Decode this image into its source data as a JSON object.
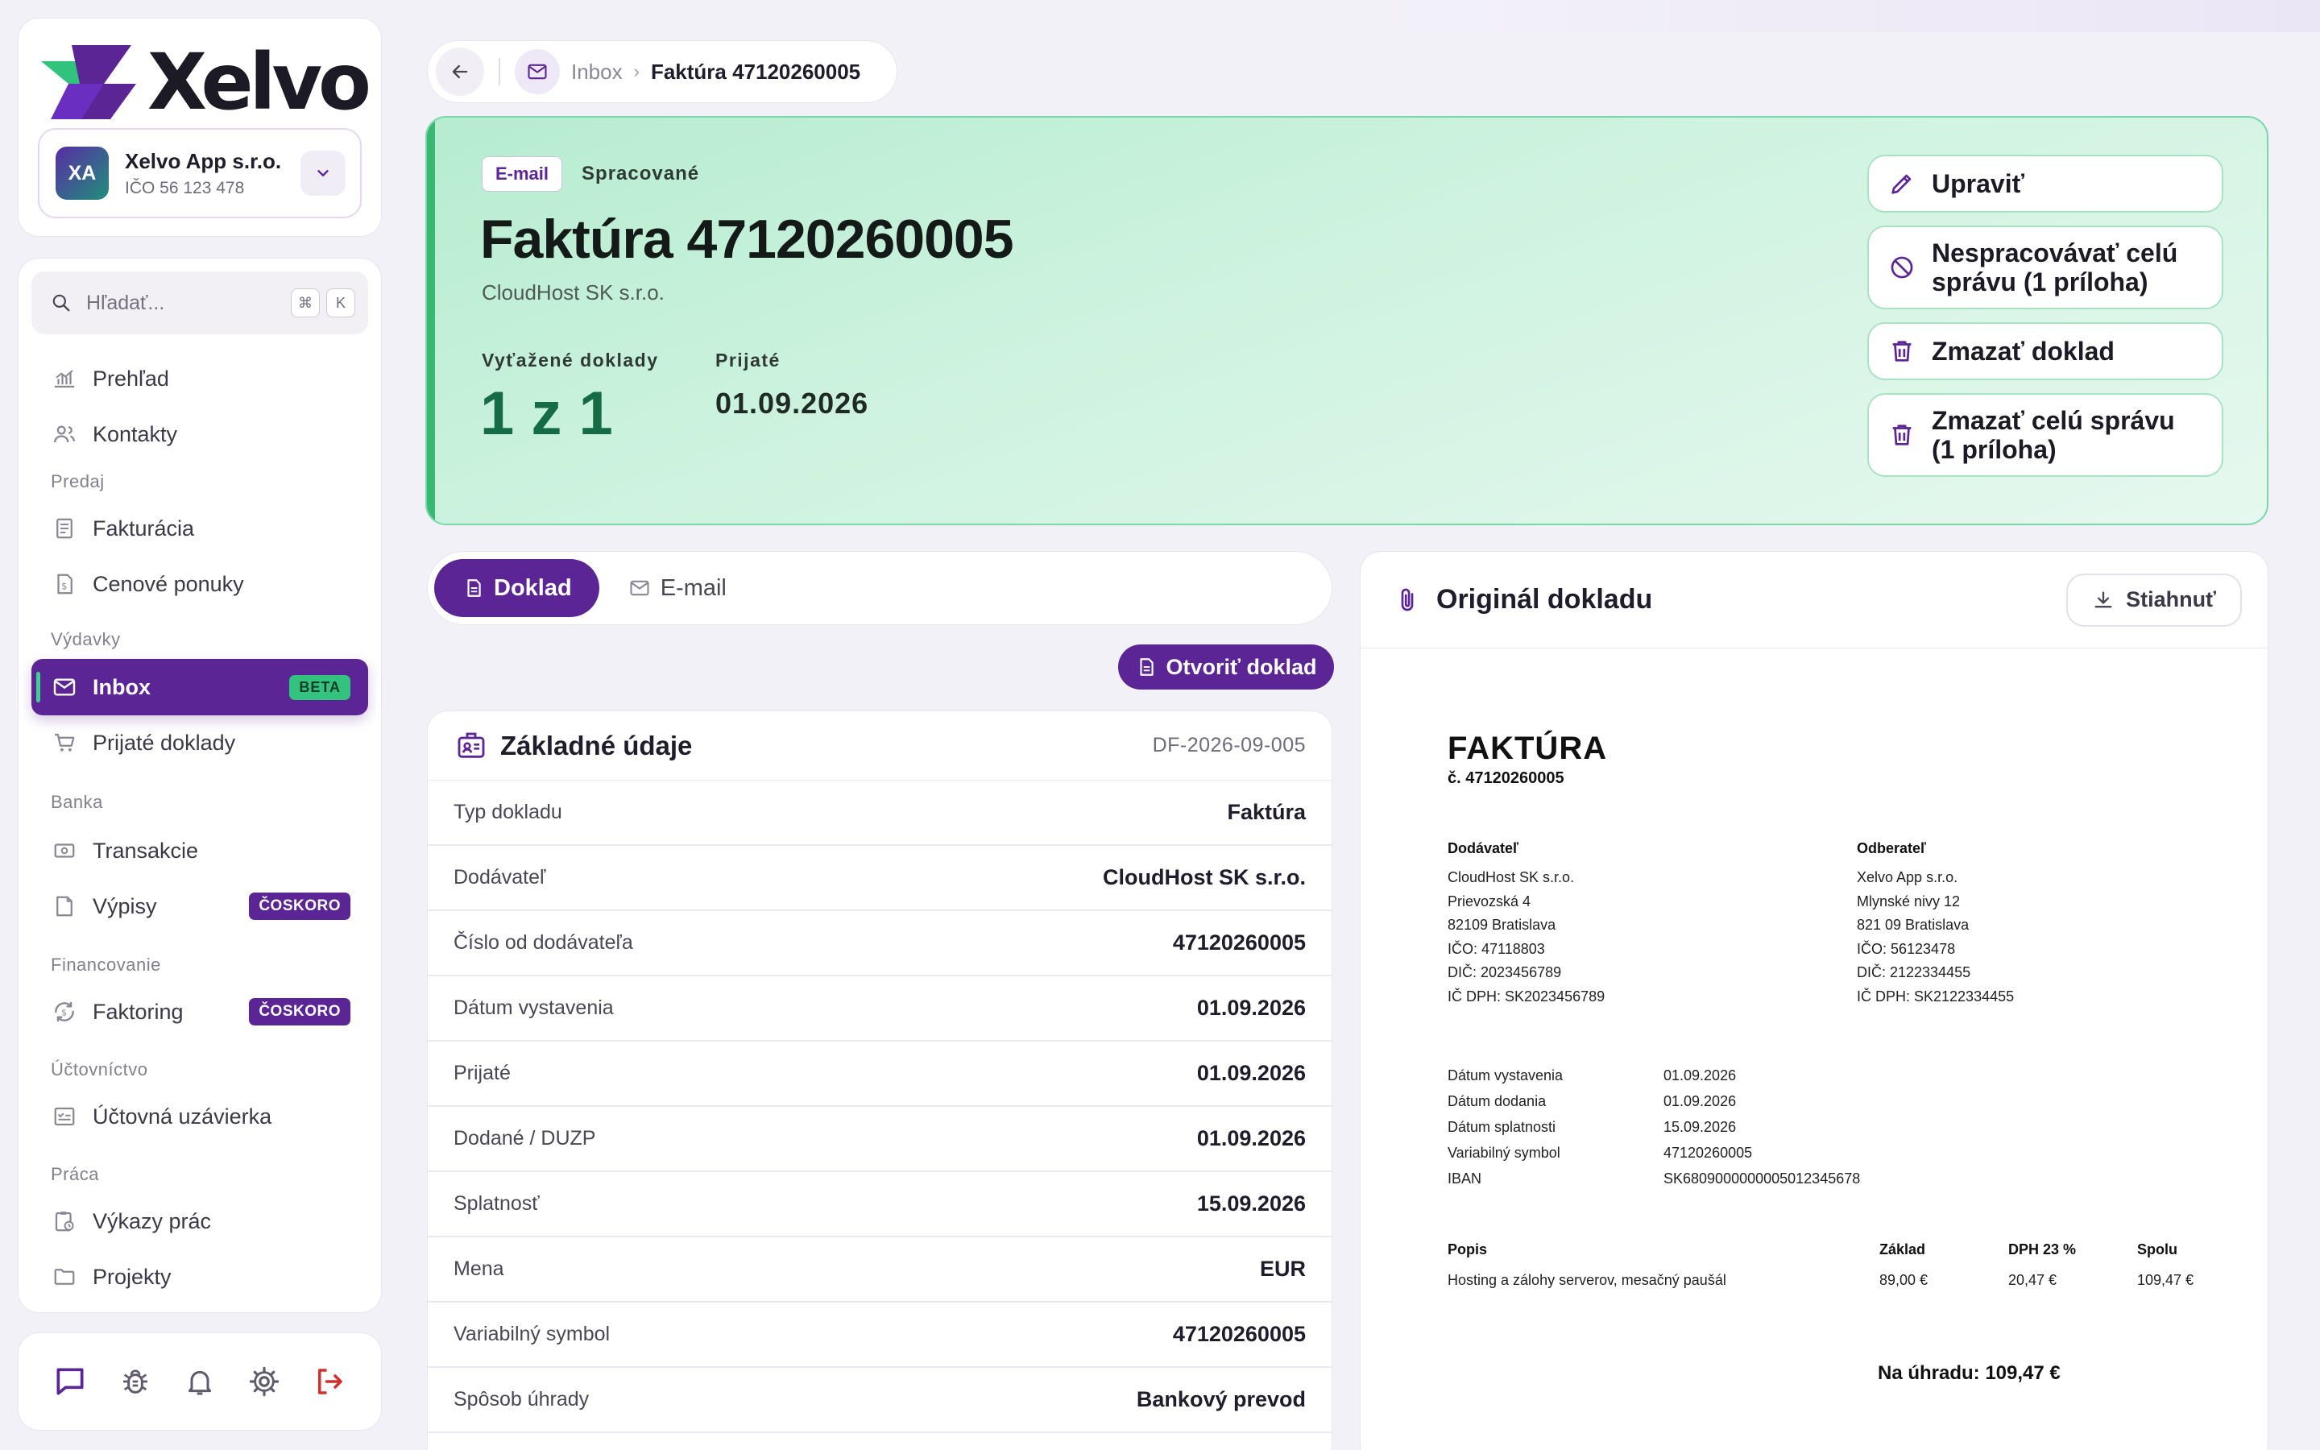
{
  "brand": {
    "name": "Xelvo",
    "accent": "#5b2596",
    "green": "#39b874"
  },
  "company": {
    "initials": "XA",
    "name": "Xelvo App s.r.o.",
    "ico": "IČO 56 123 478"
  },
  "search": {
    "placeholder": "Hľadať...",
    "kbd1": "⌘",
    "kbd2": "K"
  },
  "nav": {
    "prehlad": "Prehľad",
    "kontakty": "Kontakty",
    "sec_predaj": "Predaj",
    "fakturacia": "Fakturácia",
    "cenove": "Cenové ponuky",
    "sec_vydavky": "Výdavky",
    "inbox": "Inbox",
    "inbox_badge": "BETA",
    "prijate": "Prijaté doklady",
    "sec_banka": "Banka",
    "transakcie": "Transakcie",
    "vypisy": "Výpisy",
    "vypisy_badge": "ČOSKORO",
    "sec_financovanie": "Financovanie",
    "faktoring": "Faktoring",
    "faktoring_badge": "ČOSKORO",
    "sec_uctovnictvo": "Účtovníctvo",
    "uzavierka": "Účtovná uzávierka",
    "sec_praca": "Práca",
    "vykazy": "Výkazy prác",
    "projekty": "Projekty"
  },
  "breadcrumb": {
    "inbox": "Inbox",
    "sep": "›",
    "current": "Faktúra 47120260005"
  },
  "hero": {
    "tag": "E-mail",
    "status": "Spracované",
    "title": "Faktúra 47120260005",
    "supplier": "CloudHost SK s.r.o.",
    "extracted_label": "Vyťažené doklady",
    "extracted_value": "1 z 1",
    "received_label": "Prijaté",
    "received_value": "01.09.2026",
    "actions": {
      "edit": "Upraviť",
      "no_process": "Nespracovávať celú správu (1 príloha)",
      "delete_doc": "Zmazať doklad",
      "delete_msg": "Zmazať celú správu (1 príloha)"
    }
  },
  "tabs": {
    "doklad": "Doklad",
    "email": "E-mail"
  },
  "open_doc": "Otvoriť doklad",
  "details": {
    "title": "Základné údaje",
    "doc_id": "DF-2026-09-005",
    "rows": [
      {
        "label": "Typ dokladu",
        "value": "Faktúra"
      },
      {
        "label": "Dodávateľ",
        "value": "CloudHost SK s.r.o."
      },
      {
        "label": "Číslo od dodávateľa",
        "value": "47120260005"
      },
      {
        "label": "Dátum vystavenia",
        "value": "01.09.2026"
      },
      {
        "label": "Prijaté",
        "value": "01.09.2026"
      },
      {
        "label": "Dodané / DUZP",
        "value": "01.09.2026"
      },
      {
        "label": "Splatnosť",
        "value": "15.09.2026"
      },
      {
        "label": "Mena",
        "value": "EUR"
      },
      {
        "label": "Variabilný symbol",
        "value": "47120260005"
      },
      {
        "label": "Spôsob úhrady",
        "value": "Bankový prevod"
      }
    ]
  },
  "original": {
    "title": "Originál dokladu",
    "download": "Stiahnuť",
    "invoice": {
      "heading": "FAKTÚRA",
      "number": "č. 47120260005",
      "supplier_h": "Dodávateľ",
      "supplier": [
        "CloudHost SK s.r.o.",
        "Prievozská 4",
        "82109 Bratislava",
        "IČO: 47118803",
        "DIČ: 2023456789",
        "IČ DPH: SK2023456789"
      ],
      "customer_h": "Odberateľ",
      "customer": [
        "Xelvo App s.r.o.",
        "Mlynské nivy 12",
        "821 09 Bratislava",
        "IČO: 56123478",
        "DIČ: 2122334455",
        "IČ DPH: SK2122334455"
      ],
      "meta": [
        {
          "label": "Dátum vystavenia",
          "value": "01.09.2026"
        },
        {
          "label": "Dátum dodania",
          "value": "01.09.2026"
        },
        {
          "label": "Dátum splatnosti",
          "value": "15.09.2026"
        },
        {
          "label": "Variabilný symbol",
          "value": "47120260005"
        },
        {
          "label": "IBAN",
          "value": "SK6809000000005012345678"
        }
      ],
      "cols": {
        "popis": "Popis",
        "zaklad": "Základ",
        "dph": "DPH 23 %",
        "spolu": "Spolu"
      },
      "item": {
        "popis": "Hosting a zálohy serverov, mesačný paušál",
        "zaklad": "89,00 €",
        "dph": "20,47 €",
        "spolu": "109,47 €"
      },
      "total": "Na úhradu: 109,47 €"
    }
  }
}
